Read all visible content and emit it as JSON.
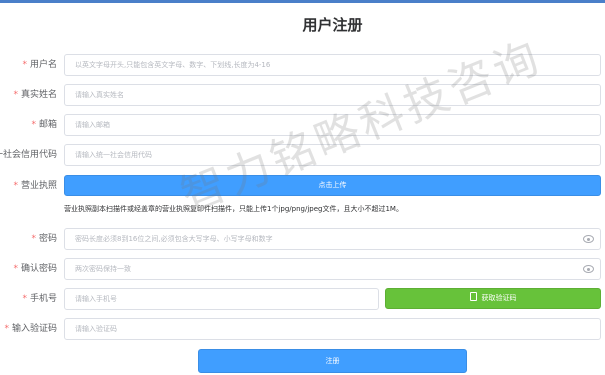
{
  "title": "用户注册",
  "required_mark": "*",
  "fields": {
    "username": {
      "label": "用户名",
      "placeholder": "以英文字母开头,只能包含英文字母、数字、下划线,长度为4-16"
    },
    "realname": {
      "label": "真实姓名",
      "placeholder": "请输入真实姓名"
    },
    "email": {
      "label": "邮箱",
      "placeholder": "请输入邮箱"
    },
    "credit_code": {
      "label": "统一社会信用代码",
      "placeholder": "请输入统一社会信用代码"
    },
    "license": {
      "label": "营业执照",
      "button": "点击上传",
      "tip": "营业执照副本扫描件或经盖章的营业执照复印件扫描件，只能上传1个jpg/png/jpeg文件，且大小不超过1M。"
    },
    "password": {
      "label": "密码",
      "placeholder": "密码长度必须8到16位之间,必须包含大写字母、小写字母和数字"
    },
    "confirm_password": {
      "label": "确认密码",
      "placeholder": "两次密码保持一致"
    },
    "phone": {
      "label": "手机号",
      "placeholder": "请输入手机号",
      "code_button": "获取验证码"
    },
    "sms_code": {
      "label": "输入验证码",
      "placeholder": "请输入验证码"
    }
  },
  "submit_label": "注册",
  "watermark": "智力铭略科技咨询",
  "colors": {
    "primary": "#409eff",
    "success": "#67c23a",
    "required": "#f56c6c"
  },
  "icons": {
    "eye": "eye-icon",
    "phone": "mobile-phone-icon"
  }
}
